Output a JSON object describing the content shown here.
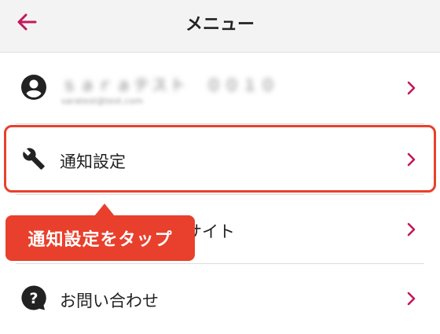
{
  "header": {
    "title": "メニュー",
    "back_icon": "arrow-left-icon"
  },
  "account": {
    "icon": "account-circle-icon",
    "name_blurred": "ｓａｒａテスト　００１０",
    "email_blurred": "saratest@test.com"
  },
  "menu": {
    "notification_settings": {
      "label": "通知設定",
      "icon": "wrench-icon"
    },
    "website": {
      "label": "スサイト"
    },
    "help": {
      "label": "お問い合わせ",
      "icon": "help-bubble-icon"
    }
  },
  "callout": {
    "text": "通知設定をタップ"
  },
  "colors": {
    "accent": "#c2185b",
    "highlight": "#e8402c",
    "header_bg": "#f3f3f3"
  }
}
